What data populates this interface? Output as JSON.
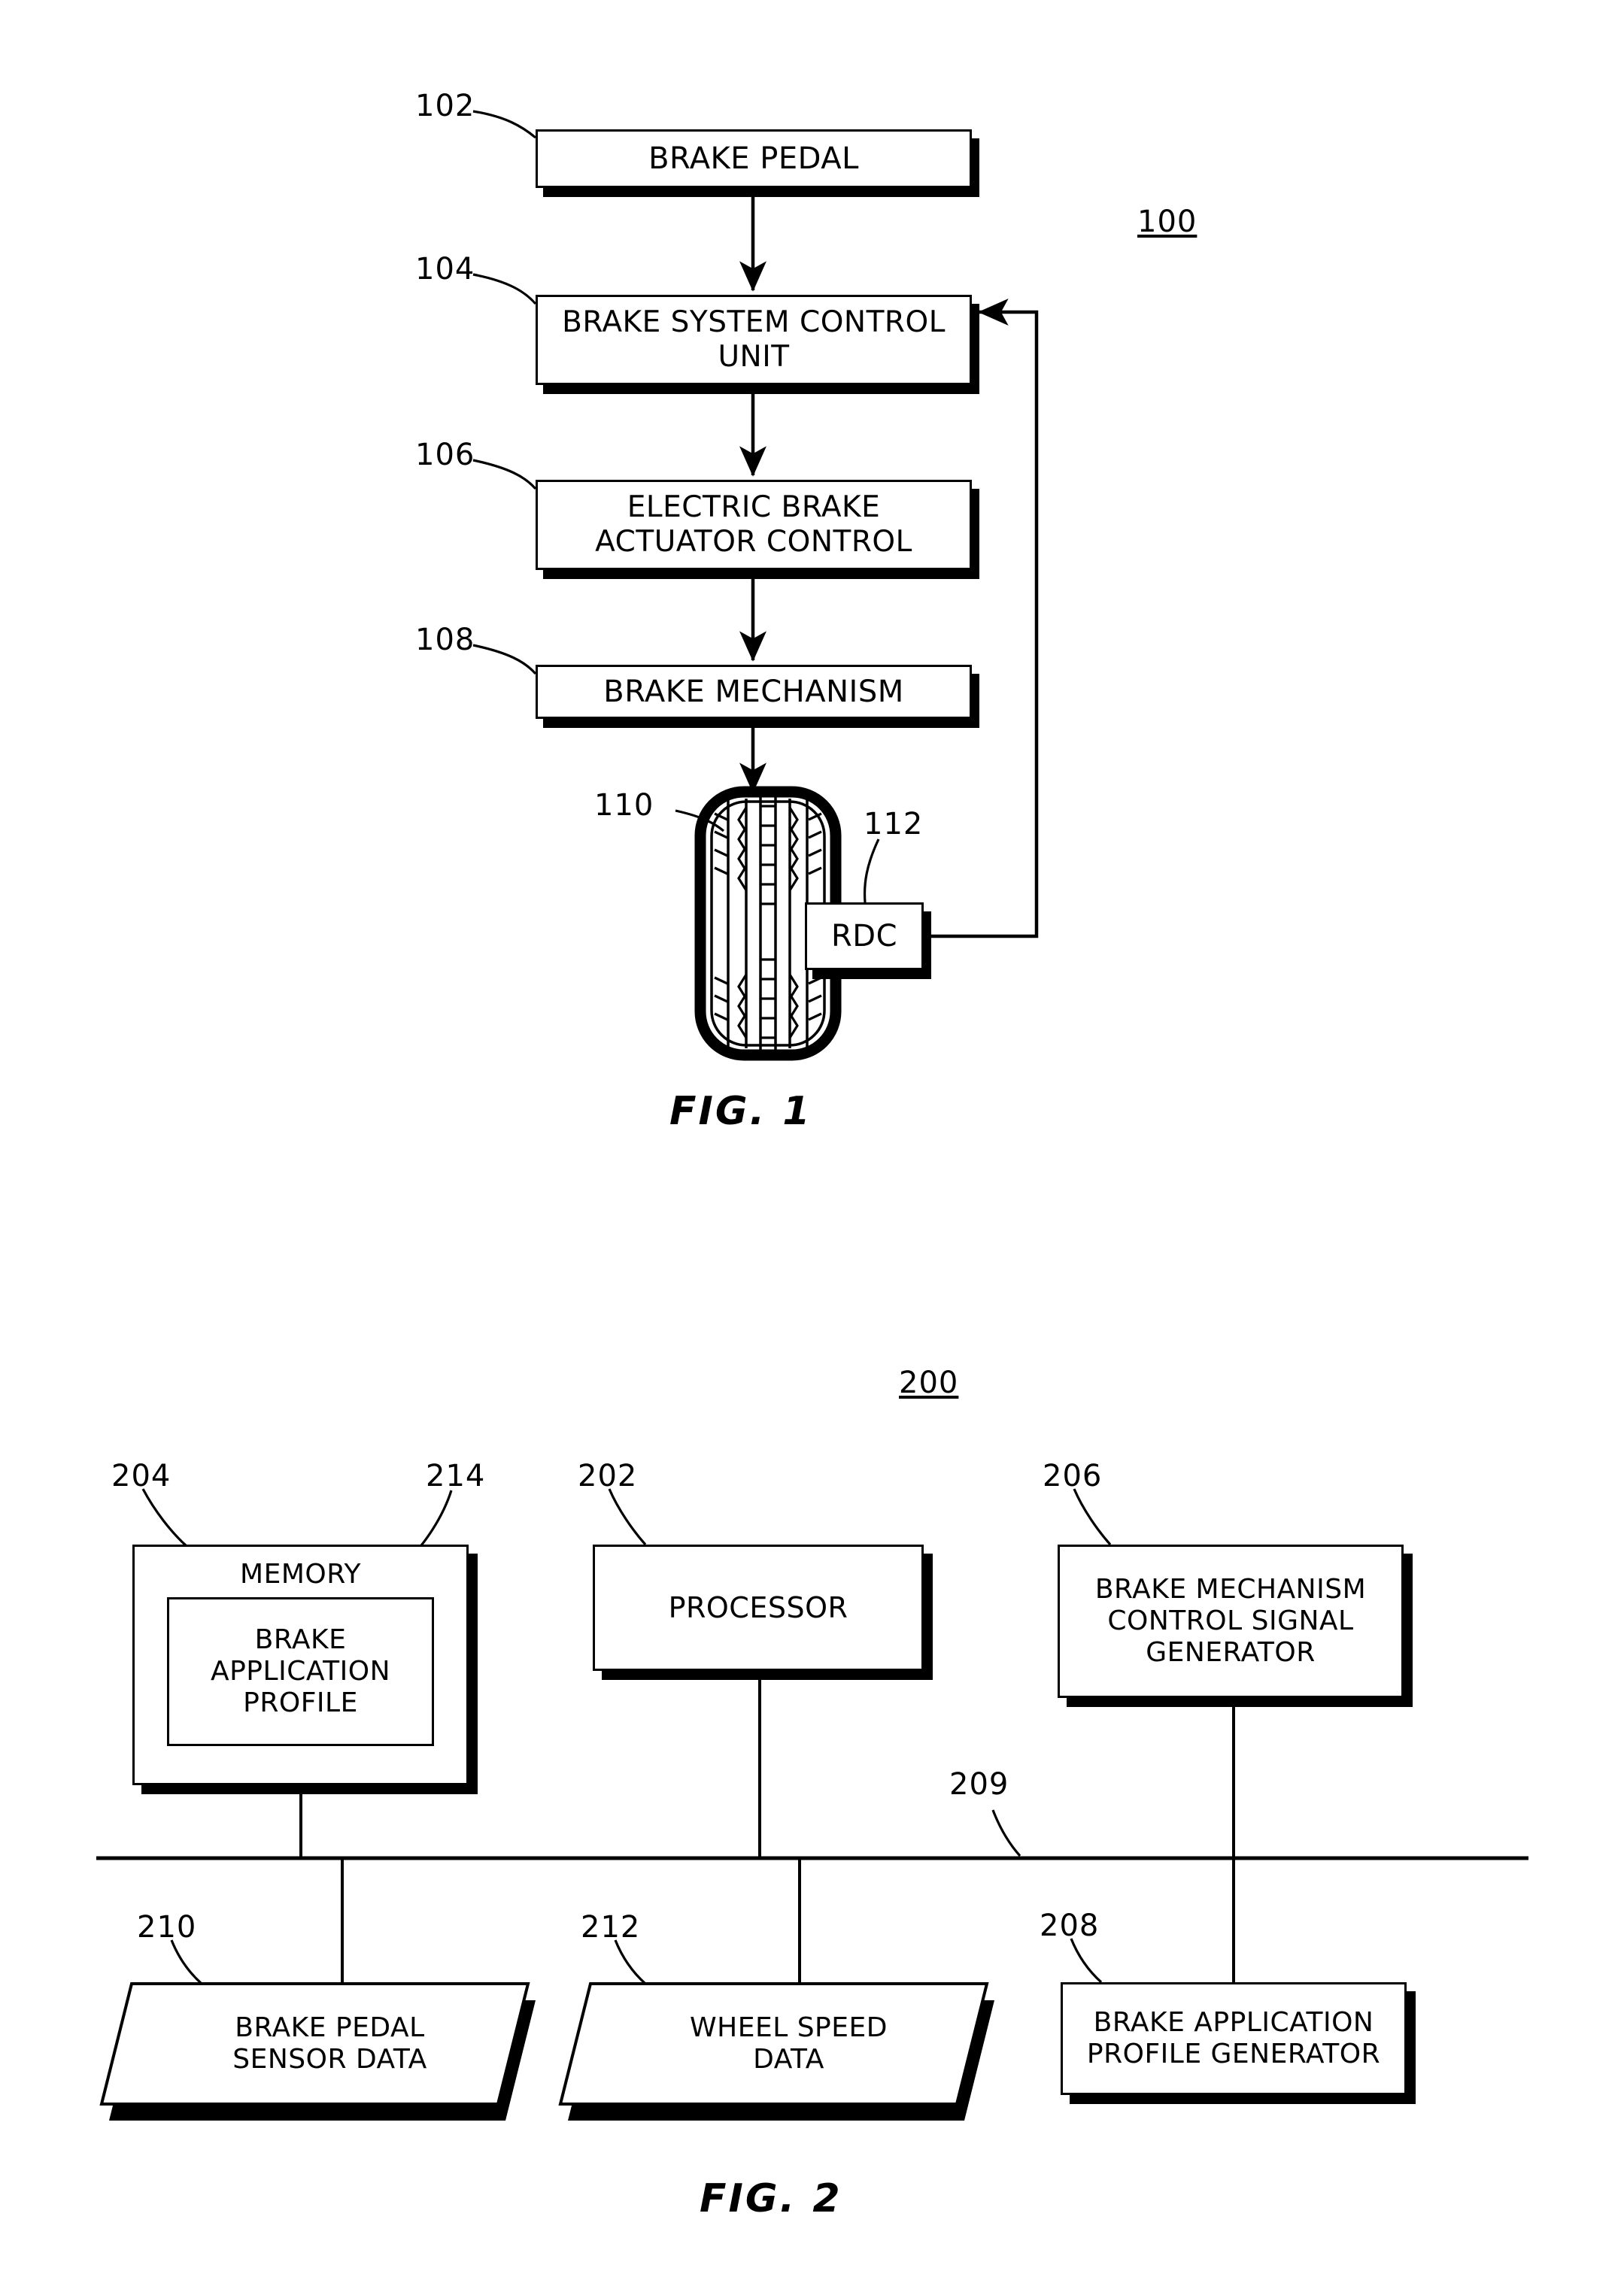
{
  "figure1": {
    "figure_label": "FIG. 1",
    "system_ref": "100",
    "nodes": [
      {
        "ref": "102",
        "label": "BRAKE PEDAL"
      },
      {
        "ref": "104",
        "label": "BRAKE SYSTEM CONTROL UNIT"
      },
      {
        "ref": "106",
        "label": "ELECTRIC BRAKE ACTUATOR CONTROL"
      },
      {
        "ref": "108",
        "label": "BRAKE MECHANISM"
      },
      {
        "ref": "110",
        "label": ""
      },
      {
        "ref": "112",
        "label": "RDC"
      }
    ],
    "node_lines": {
      "brake_pedal": [
        "BRAKE PEDAL"
      ],
      "brake_system_control_unit": [
        "BRAKE SYSTEM CONTROL",
        "UNIT"
      ],
      "electric_brake_actuator_control": [
        "ELECTRIC BRAKE",
        "ACTUATOR CONTROL"
      ],
      "brake_mechanism": [
        "BRAKE MECHANISM"
      ],
      "rdc": [
        "RDC"
      ]
    },
    "wheel_ref": "110",
    "rdc_ref": "112"
  },
  "figure2": {
    "figure_label": "FIG. 2",
    "system_ref": "200",
    "bus_ref": "209",
    "memory": {
      "ref": "204",
      "label": "MEMORY",
      "inner_ref": "214",
      "inner_lines": [
        "BRAKE",
        "APPLICATION",
        "PROFILE"
      ]
    },
    "processor": {
      "ref": "202",
      "label": "PROCESSOR"
    },
    "signal_generator": {
      "ref": "206",
      "lines": [
        "BRAKE MECHANISM",
        "CONTROL SIGNAL",
        "GENERATOR"
      ]
    },
    "brake_pedal_sensor_data": {
      "ref": "210",
      "lines": [
        "BRAKE PEDAL",
        "SENSOR DATA"
      ]
    },
    "wheel_speed_data": {
      "ref": "212",
      "lines": [
        "WHEEL SPEED",
        "DATA"
      ]
    },
    "profile_generator": {
      "ref": "208",
      "lines": [
        "BRAKE APPLICATION",
        "PROFILE GENERATOR"
      ]
    }
  },
  "colors": {
    "ink": "#000000",
    "paper": "#ffffff"
  }
}
